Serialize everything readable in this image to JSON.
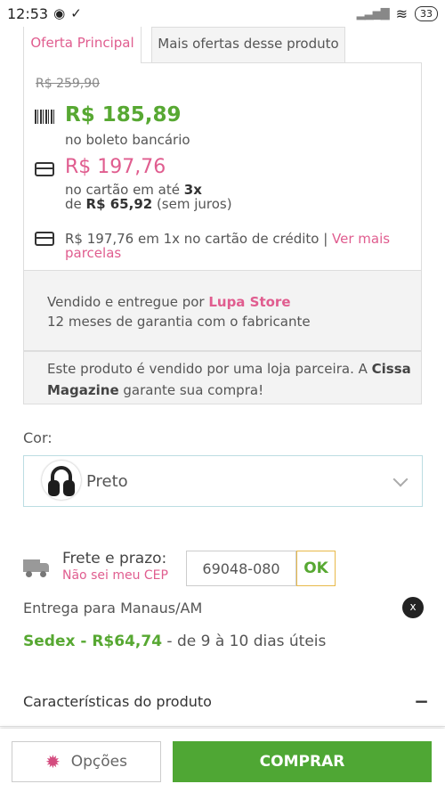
{
  "status_bar": {
    "time": "12:53",
    "battery": "33"
  },
  "tabs": {
    "main": "Oferta Principal",
    "other": "Mais ofertas desse produto"
  },
  "price": {
    "old": "R$ 259,90",
    "boleto_price": "R$ 185,89",
    "boleto_label": "no boleto bancário",
    "card_price": "R$ 197,76",
    "installments_line1_prefix": "no cartão em até ",
    "installments_count": "3x",
    "installments_line2_prefix": "de ",
    "installment_value": "R$ 65,92",
    "installments_suffix": " (sem juros)",
    "onex_text": "R$ 197,76 em 1x no cartão de crédito | ",
    "more_installments_link": "Ver mais parcelas"
  },
  "seller": {
    "prefix": "Vendido e entregue por ",
    "name": "Lupa Store",
    "warranty": "12 meses de garantia com o fabricante"
  },
  "partner": {
    "prefix": "Este produto é vendido por uma loja parceira. A ",
    "store": "Cissa Magazine",
    "suffix": " garante sua compra!"
  },
  "color": {
    "label": "Cor:",
    "selected": "Preto"
  },
  "shipping": {
    "label": "Frete e prazo:",
    "unknown_cep_link": "Não sei meu CEP",
    "cep_value": "69048-080",
    "ok_label": "OK",
    "delivery_to": "Entrega para Manaus/AM",
    "close_label": "x",
    "method": "Sedex - R$64,74",
    "term": " - de 9 à  10 dias úteis"
  },
  "characteristics": {
    "label": "Características do produto",
    "toggle": "−"
  },
  "bottom_bar": {
    "options_label": "Opções",
    "buy_label": "COMPRAR"
  },
  "colors": {
    "green": "#57a832",
    "pink": "#e05d8f",
    "buy_button": "#4fa734"
  }
}
